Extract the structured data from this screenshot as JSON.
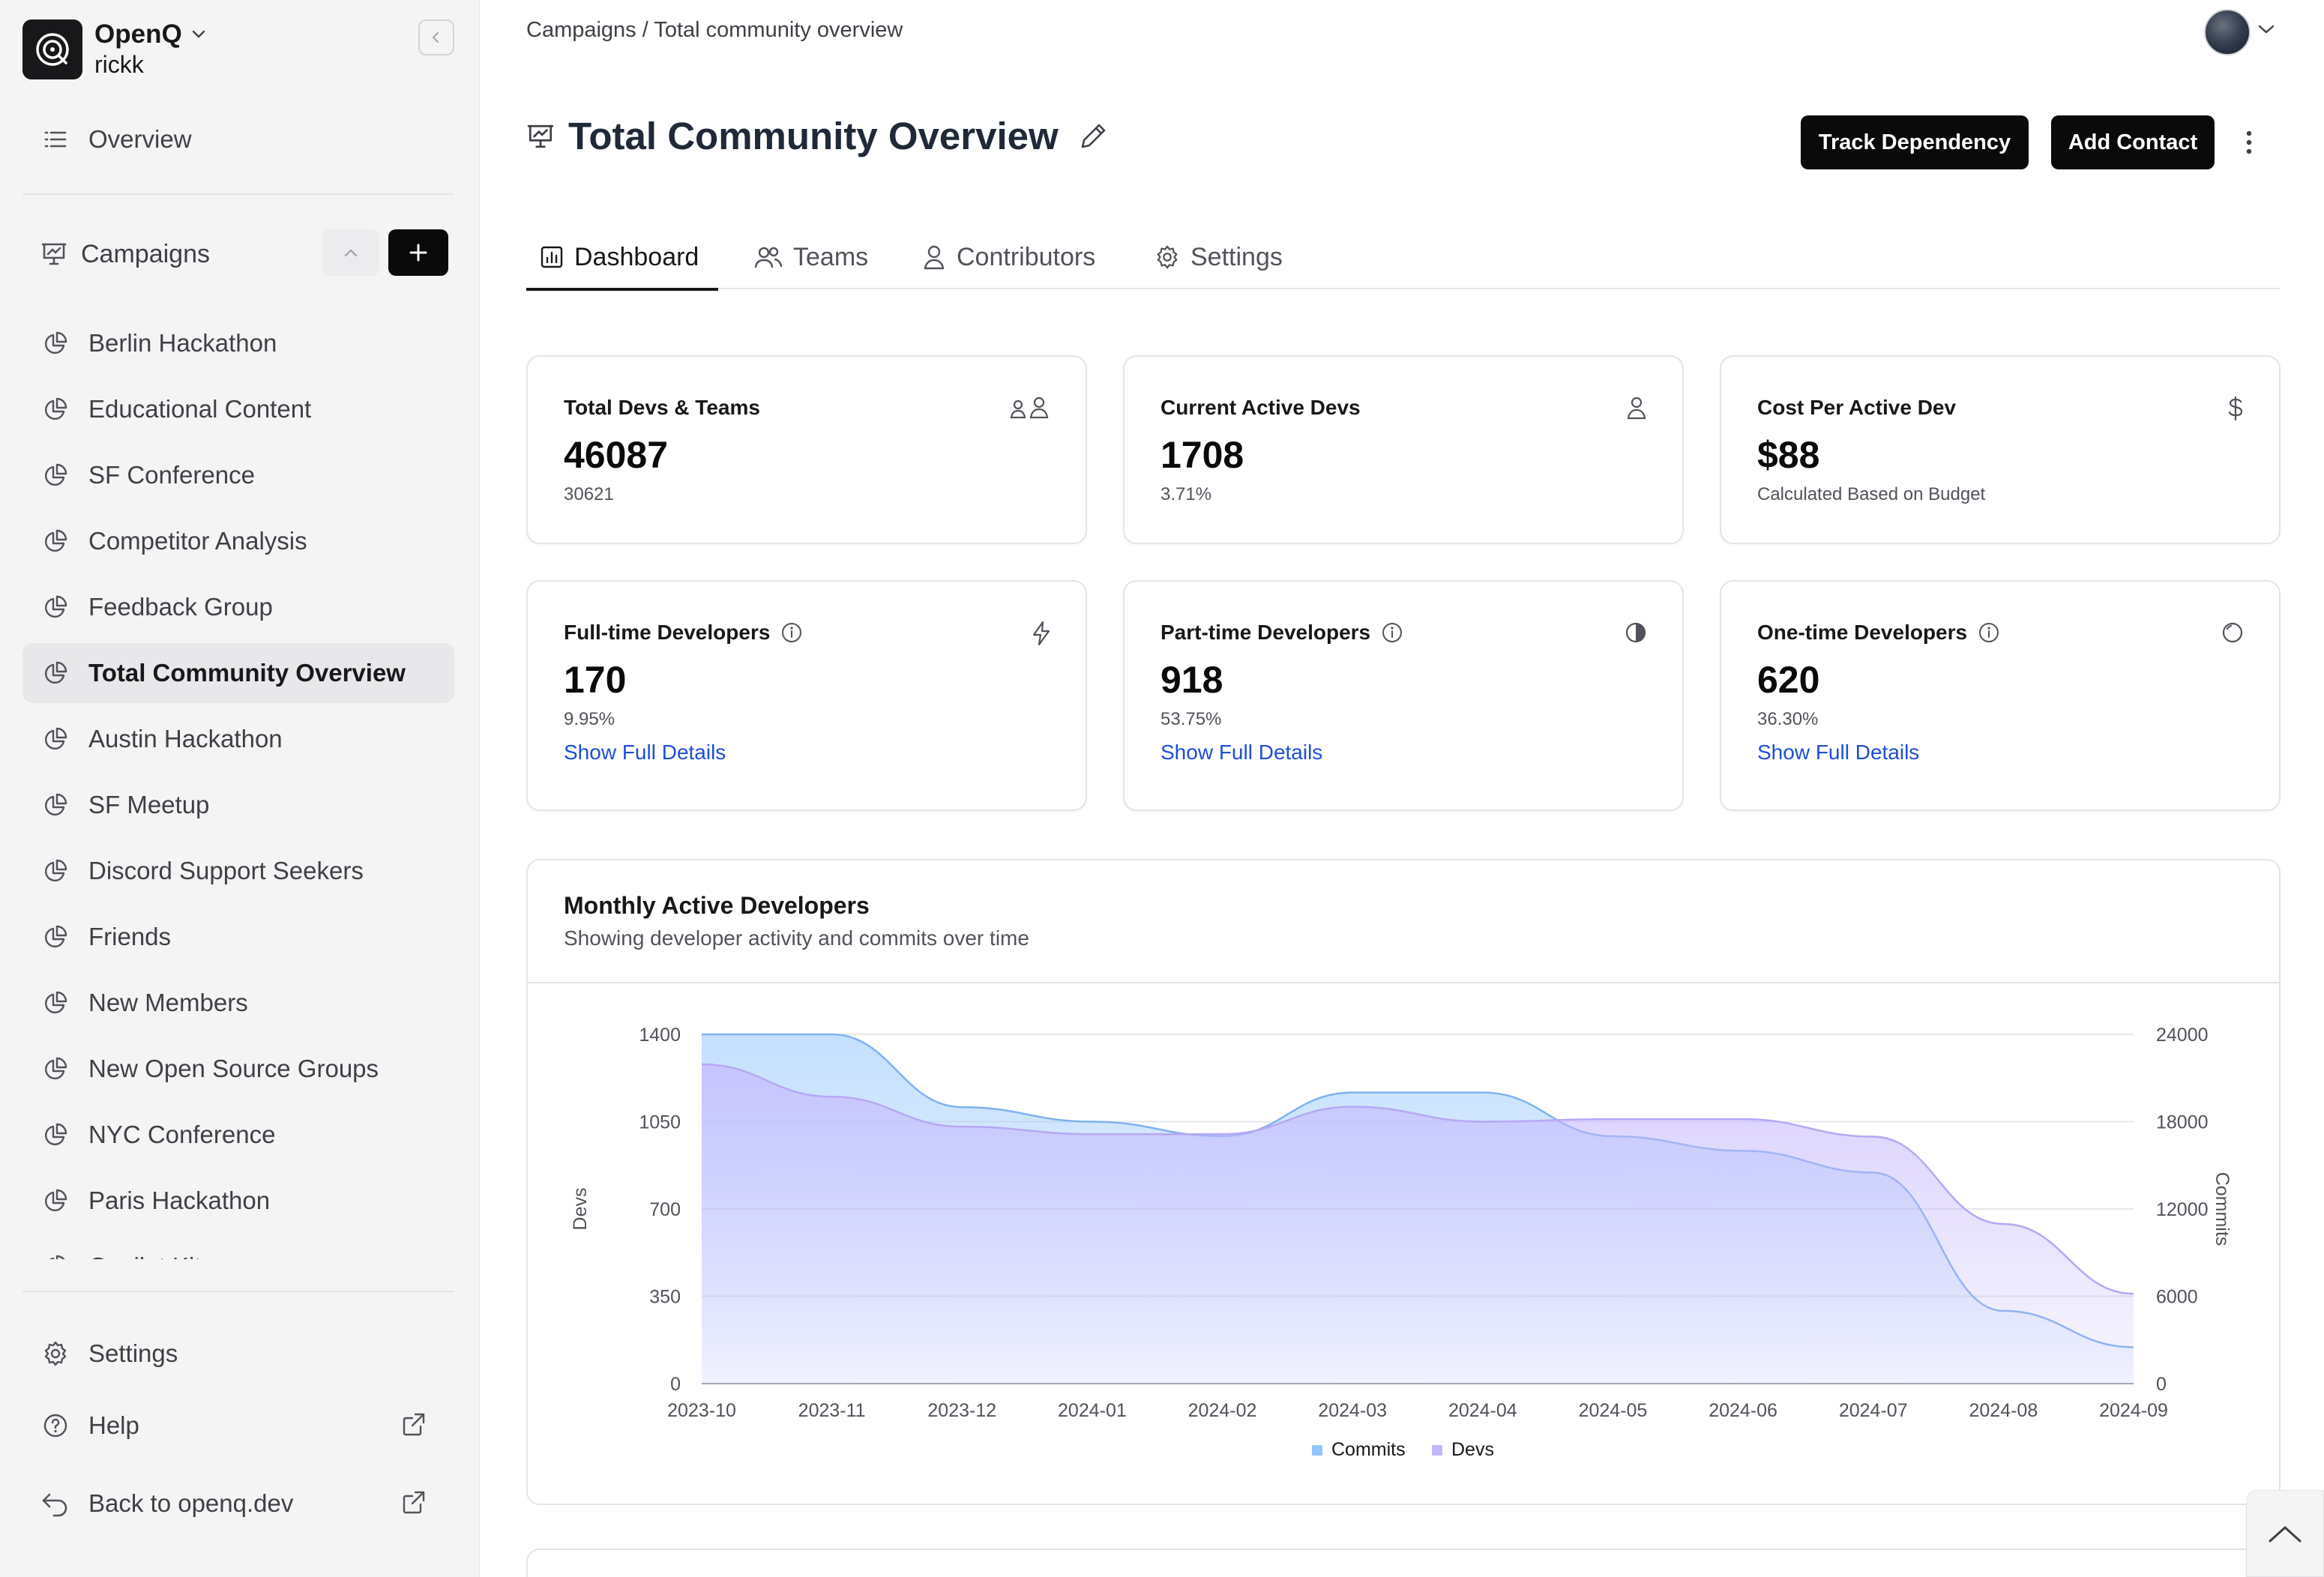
{
  "org": {
    "name": "OpenQ",
    "user": "rickk"
  },
  "sidebar": {
    "overview": "Overview",
    "campaigns_label": "Campaigns",
    "campaigns": [
      "Berlin Hackathon",
      "Educational Content",
      "SF Conference",
      "Competitor Analysis",
      "Feedback Group",
      "Total Community Overview",
      "Austin Hackathon",
      "SF Meetup",
      "Discord Support Seekers",
      "Friends",
      "New Members",
      "New Open Source Groups",
      "NYC Conference",
      "Paris Hackathon",
      "Copilot Kit"
    ],
    "active_campaign": "Total Community Overview",
    "settings": "Settings",
    "help": "Help",
    "back": "Back to openq.dev"
  },
  "breadcrumb": "Campaigns / Total community overview",
  "page": {
    "title": "Total Community Overview",
    "track_button": "Track Dependency",
    "add_contact_button": "Add Contact"
  },
  "tabs": [
    "Dashboard",
    "Teams",
    "Contributors",
    "Settings"
  ],
  "active_tab": "Dashboard",
  "stats": {
    "total_devs": {
      "title": "Total Devs & Teams",
      "value": "46087",
      "sub": "30621"
    },
    "active_devs": {
      "title": "Current Active Devs",
      "value": "1708",
      "sub": "3.71%"
    },
    "cost": {
      "title": "Cost Per Active Dev",
      "value": "$88",
      "sub": "Calculated Based on Budget"
    },
    "fulltime": {
      "title": "Full-time Developers",
      "value": "170",
      "sub": "9.95%",
      "link": "Show Full Details"
    },
    "parttime": {
      "title": "Part-time Developers",
      "value": "918",
      "sub": "53.75%",
      "link": "Show Full Details"
    },
    "onetime": {
      "title": "One-time Developers",
      "value": "620",
      "sub": "36.30%",
      "link": "Show Full Details"
    }
  },
  "chart": {
    "title": "Monthly Active Developers",
    "subtitle": "Showing developer activity and commits over time"
  },
  "chart_data": {
    "type": "area",
    "x": [
      "2023-10",
      "2023-11",
      "2023-12",
      "2024-01",
      "2024-02",
      "2024-03",
      "2024-04",
      "2024-05",
      "2024-06",
      "2024-07",
      "2024-08",
      "2024-09"
    ],
    "series": [
      {
        "name": "Commits",
        "axis": "right",
        "color": "#93c5fd",
        "values": [
          24000,
          24000,
          19000,
          18000,
          17000,
          20000,
          20000,
          17000,
          16000,
          14500,
          5000,
          2500
        ]
      },
      {
        "name": "Devs",
        "axis": "left",
        "color": "#c4b5fd",
        "values": [
          1280,
          1150,
          1030,
          1000,
          1000,
          1110,
          1050,
          1060,
          1060,
          990,
          640,
          360
        ]
      }
    ],
    "ylabel": "Devs",
    "ylabel_right": "Commits",
    "ylim": [
      0,
      1400
    ],
    "ylim_right": [
      0,
      24000
    ],
    "yticks": [
      "0",
      "350",
      "700",
      "1050",
      "1400"
    ],
    "yticks_right": [
      "0",
      "6000",
      "12000",
      "18000",
      "24000"
    ],
    "grid": true,
    "legend": "bottom-center"
  }
}
